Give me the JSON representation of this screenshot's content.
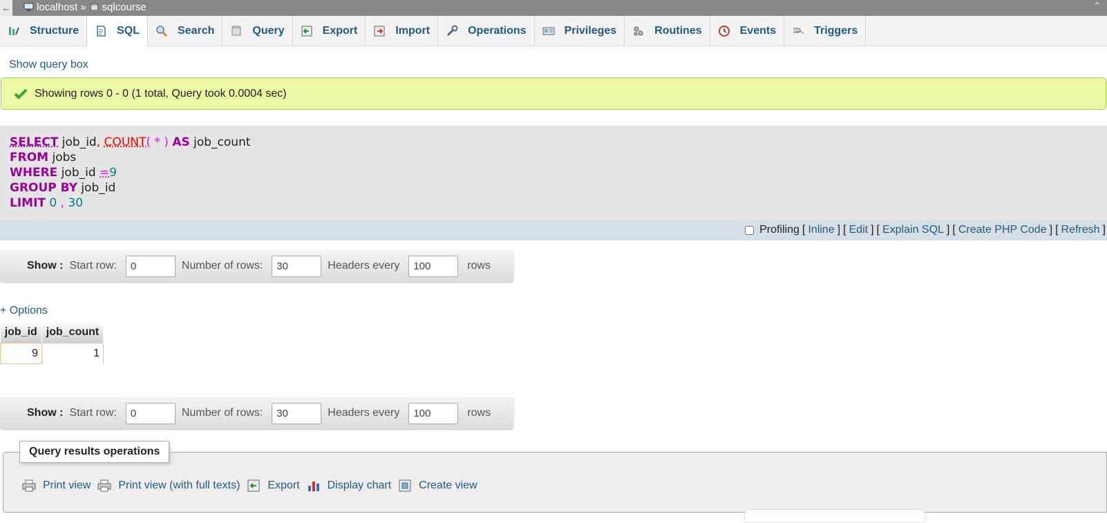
{
  "breadcrumb": {
    "back_symbol": "←",
    "server": "localhost",
    "separator": "»",
    "database": "sqlcourse",
    "collapse_symbol": "⌃"
  },
  "tabs": [
    {
      "label": "Structure",
      "icon": "structure-icon",
      "active": false
    },
    {
      "label": "SQL",
      "icon": "sql-icon",
      "active": true
    },
    {
      "label": "Search",
      "icon": "search-icon",
      "active": false
    },
    {
      "label": "Query",
      "icon": "query-icon",
      "active": false
    },
    {
      "label": "Export",
      "icon": "export-icon",
      "active": false
    },
    {
      "label": "Import",
      "icon": "import-icon",
      "active": false
    },
    {
      "label": "Operations",
      "icon": "wrench-icon",
      "active": false
    },
    {
      "label": "Privileges",
      "icon": "privileges-icon",
      "active": false
    },
    {
      "label": "Routines",
      "icon": "routines-icon",
      "active": false
    },
    {
      "label": "Events",
      "icon": "clock-icon",
      "active": false
    },
    {
      "label": "Triggers",
      "icon": "triggers-icon",
      "active": false
    }
  ],
  "show_query_box": "Show query box",
  "message": {
    "text": "Showing rows 0 - 0 (1 total, Query took 0.0004 sec)",
    "color": "#ebf8a4"
  },
  "sql": {
    "select_kw": "SELECT",
    "col1": "job_id",
    "comma1": ",",
    "count_fn": "COUNT",
    "paren_open": "(",
    "star": "*",
    "paren_close": ")",
    "as_kw": "AS",
    "alias": "job_count",
    "from_kw": "FROM",
    "table": "jobs",
    "where_kw": "WHERE",
    "where_col": "job_id",
    "eq": "=",
    "where_val": "9",
    "group_kw": "GROUP BY",
    "group_col": "job_id",
    "limit_kw": "LIMIT",
    "limit_offset": "0",
    "limit_comma": ",",
    "limit_count": "30"
  },
  "sql_actions": {
    "profiling_label": "Profiling",
    "profiling_checked": false,
    "inline": "Inline",
    "edit": "Edit",
    "explain": "Explain SQL",
    "php": "Create PHP Code",
    "refresh": "Refresh",
    "lb": "[",
    "rb": "]"
  },
  "navigation": {
    "show_label": "Show :",
    "start_row_label": "Start row:",
    "start_row_value": "0",
    "num_rows_label": "Number of rows:",
    "num_rows_value": "30",
    "headers_every_label": "Headers every",
    "headers_every_value": "100",
    "rows_label": "rows"
  },
  "options_link": "+ Options",
  "results": {
    "columns": [
      "job_id",
      "job_count"
    ],
    "rows": [
      [
        "9",
        "1"
      ]
    ]
  },
  "query_ops": {
    "legend": "Query results operations",
    "items": [
      {
        "label": "Print view",
        "icon": "print-icon"
      },
      {
        "label": "Print view (with full texts)",
        "icon": "print-icon"
      },
      {
        "label": "Export",
        "icon": "export-icon"
      },
      {
        "label": "Display chart",
        "icon": "chart-icon"
      },
      {
        "label": "Create view",
        "icon": "view-icon"
      }
    ]
  }
}
